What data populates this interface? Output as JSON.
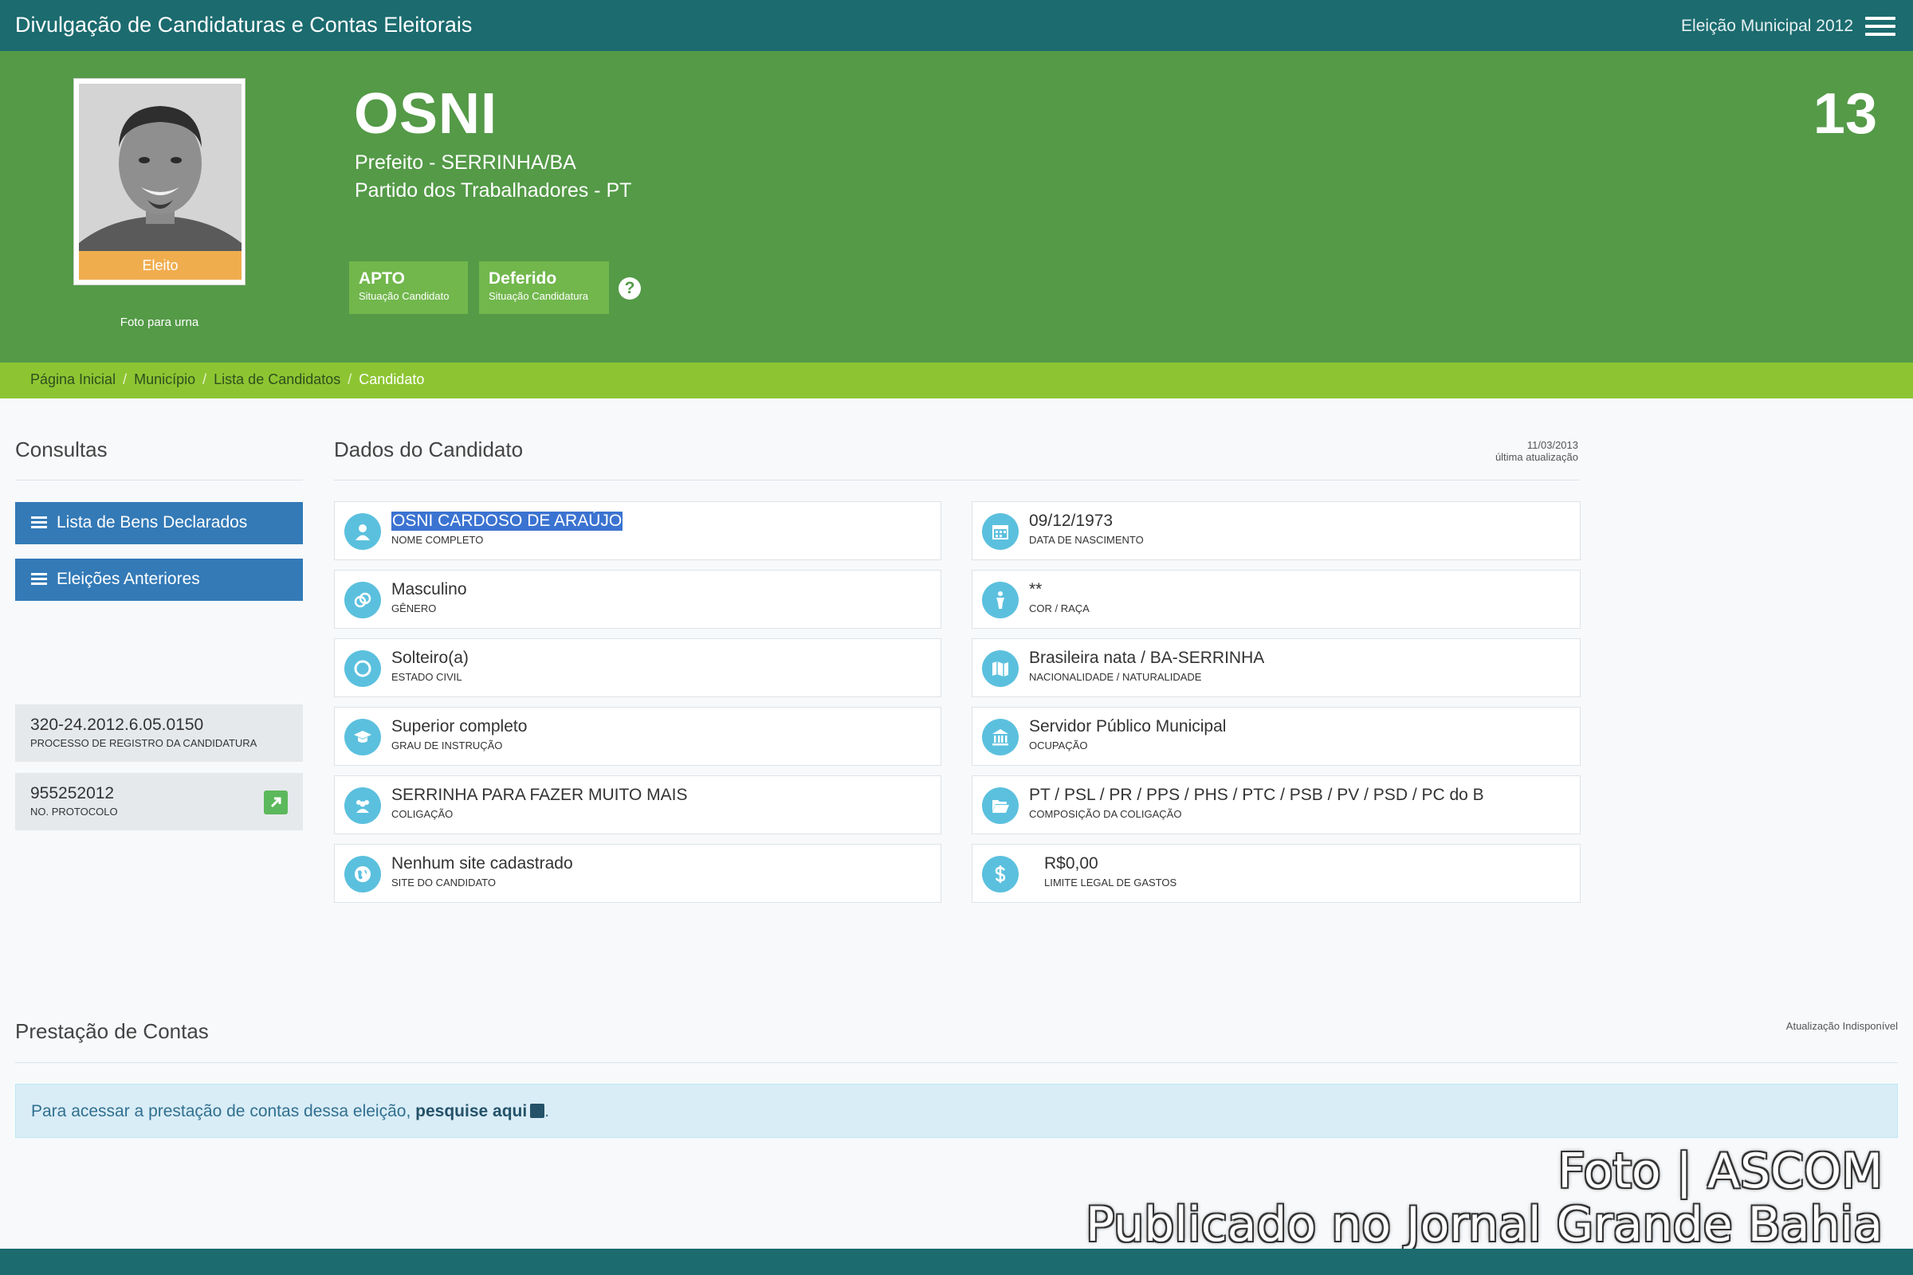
{
  "header": {
    "title": "Divulgação de Candidaturas e Contas Eleitorais",
    "election": "Eleição Municipal 2012"
  },
  "candidate": {
    "name": "OSNI",
    "office": "Prefeito - SERRINHA/BA",
    "party": "Partido dos Trabalhadores - PT",
    "number": "13",
    "photo_badge": "Eleito",
    "photo_caption": "Foto para urna",
    "status_candidate": {
      "value": "APTO",
      "label": "Situação Candidato"
    },
    "status_candidacy": {
      "value": "Deferido",
      "label": "Situação Candidatura"
    }
  },
  "breadcrumb": {
    "items": [
      "Página Inicial",
      "Município",
      "Lista de Candidatos"
    ],
    "current": "Candidato"
  },
  "sidebar": {
    "title": "Consultas",
    "buttons": [
      "Lista de Bens Declarados",
      "Eleições Anteriores"
    ],
    "process": {
      "value": "320-24.2012.6.05.0150",
      "label": "PROCESSO DE REGISTRO DA CANDIDATURA"
    },
    "protocol": {
      "value": "955252012",
      "label": "NO. PROTOCOLO"
    }
  },
  "main": {
    "title": "Dados do Candidato",
    "updated_date": "11/03/2013",
    "updated_label": "última atualização",
    "fields": [
      {
        "value": "OSNI CARDOSO DE ARAÚJO",
        "label": "NOME COMPLETO",
        "icon": "user-icon"
      },
      {
        "value": "09/12/1973",
        "label": "DATA DE NASCIMENTO",
        "icon": "calendar-icon"
      },
      {
        "value": "Masculino",
        "label": "GÊNERO",
        "icon": "gender-icon"
      },
      {
        "value": "**",
        "label": "COR / RAÇA",
        "icon": "person-icon"
      },
      {
        "value": "Solteiro(a)",
        "label": "ESTADO CIVIL",
        "icon": "ring-icon"
      },
      {
        "value": "Brasileira nata / BA-SERRINHA",
        "label": "NACIONALIDADE / NATURALIDADE",
        "icon": "map-icon"
      },
      {
        "value": "Superior completo",
        "label": "GRAU DE INSTRUÇÃO",
        "icon": "graduation-cap-icon"
      },
      {
        "value": "Servidor Público Municipal",
        "label": "OCUPAÇÃO",
        "icon": "institution-icon"
      },
      {
        "value": "SERRINHA PARA FAZER MUITO MAIS",
        "label": "COLIGAÇÃO",
        "icon": "group-icon"
      },
      {
        "value": "PT / PSL / PR / PPS / PHS / PTC / PSB / PV / PSD / PC do B",
        "label": "COMPOSIÇÃO DA COLIGAÇÃO",
        "icon": "folder-open-icon"
      },
      {
        "value": "Nenhum site cadastrado",
        "label": "SITE DO CANDIDATO",
        "icon": "globe-icon"
      },
      {
        "value": "R$0,00",
        "label": "LIMITE LEGAL DE GASTOS",
        "icon": "dollar-icon"
      }
    ]
  },
  "accounts": {
    "title": "Prestação de Contas",
    "status": "Atualização Indisponível",
    "text": "Para acessar a prestação de contas dessa eleição,",
    "link": "pesquise aqui",
    "end": "."
  },
  "watermark": {
    "line1": "Foto | ASCOM",
    "line2": "Publicado no Jornal Grande Bahia"
  },
  "colors": {
    "topbar": "#1b6b6f",
    "hero": "#549a47",
    "breadcrumb": "#8dc532",
    "button": "#337ab7",
    "icon_circle": "#5bc0de",
    "elected_badge": "#f0ad4e"
  }
}
